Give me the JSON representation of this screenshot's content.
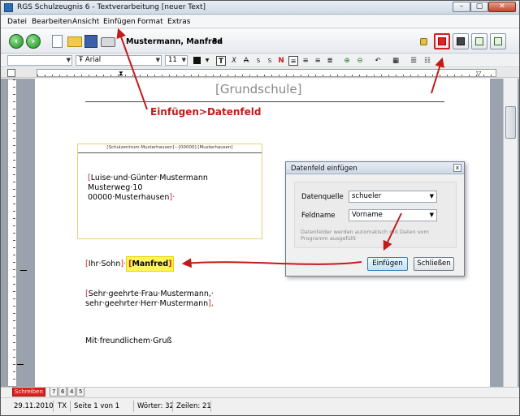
{
  "window": {
    "title": "RGS Schulzeugnis 6 - Textverarbeitung [neuer Text]",
    "buttons": {
      "minimize": "–",
      "maximize": "▢",
      "close": "✕"
    }
  },
  "menu": {
    "items": [
      "Datei",
      "Bearbeiten",
      "Ansicht",
      "Einfügen",
      "Format",
      "Extras"
    ]
  },
  "toolbar": {
    "back_icon": "back-arrow-icon",
    "forward_icon": "forward-arrow-icon",
    "student_name": "Mustermann, Manfred",
    "student_class": "3a"
  },
  "format_toolbar": {
    "font": "Arial",
    "font_size": "11",
    "bold": "T",
    "italic": "X",
    "strike": "A",
    "superscript": "S",
    "subscript": "S",
    "clear": "N"
  },
  "document": {
    "school": "[Grundschule]",
    "annotation": "Einfügen>Datenfeld",
    "sender_line": "[Schulzentrum·Musterhausen]·-·[00000]·[Musterhausen]",
    "address": {
      "line1_open": "[",
      "line1": "Luise·und·Günter·Mustermann",
      "line2": "Musterweg·10",
      "line3": "00000·Musterhausen",
      "line3_close": "]·"
    },
    "greeting": {
      "prefix_open": "[",
      "prefix": "Ihr·Sohn",
      "prefix_close": "]·",
      "field_open": "[",
      "field": "Manfred",
      "field_close": "]"
    },
    "salutation": {
      "open": "[",
      "line1": "Sehr·geehrte·Frau·Mustermann,·",
      "line2": "sehr·geehrter·Herr·Mustermann",
      "close": "],"
    },
    "closing": "Mit·freundlichem·Gruß"
  },
  "dialog": {
    "title": "Datenfeld einfügen",
    "close": "x",
    "source_label": "Datenquelle",
    "source_value": "schueler",
    "field_label": "Feldname",
    "field_value": "Vorname",
    "hint": "Datenfelder werden automatisch mit Daten vom Programm ausgefüllt",
    "insert_button": "Einfügen",
    "close_button": "Schließen"
  },
  "tabs": [
    "Schreiben",
    "7",
    "6",
    "4",
    "5"
  ],
  "status": {
    "date": "29.11.2010",
    "mode": "TX",
    "page": "Seite 1 von 1",
    "words": "Wörter: 32",
    "lines": "Zeilen: 21"
  },
  "colors": {
    "accent_red": "#c31a1a",
    "highlight": "#fff45a"
  }
}
